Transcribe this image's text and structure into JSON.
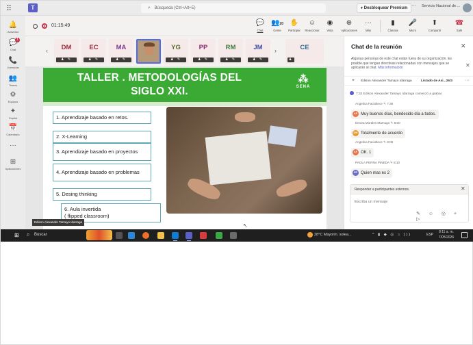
{
  "titlebar": {
    "search_placeholder": "Búsqueda (Ctrl+Alt+E)",
    "premium_label": "Desbloquear Premium",
    "more": "···",
    "org_label": "Servicio Nacional de ..."
  },
  "rail": {
    "items": [
      {
        "icon": "🔔",
        "label": "Actividad",
        "badge": ""
      },
      {
        "icon": "💬",
        "label": "Chat",
        "badge": "1"
      },
      {
        "icon": "📞",
        "label": "Llamadas",
        "badge": ""
      },
      {
        "icon": "👥",
        "label": "Teams",
        "badge": ""
      },
      {
        "icon": "⚙",
        "label": "Equipos",
        "badge": ""
      },
      {
        "icon": "✦",
        "label": "Copilot",
        "badge": ""
      },
      {
        "icon": "📅",
        "label": "Calendario",
        "badge": ""
      },
      {
        "icon": "···",
        "label": "",
        "badge": ""
      },
      {
        "icon": "⊞",
        "label": "Aplicaciones",
        "badge": ""
      }
    ]
  },
  "meeting": {
    "timer": "01:15:49",
    "controls": [
      {
        "icon": "💬",
        "label": "Chat",
        "active": true
      },
      {
        "icon": "👥",
        "label": "Gente",
        "count": "20"
      },
      {
        "icon": "✋",
        "label": "Participar"
      },
      {
        "icon": "☺",
        "label": "Reaccionar"
      },
      {
        "icon": "◉",
        "label": "Vista"
      },
      {
        "icon": "⊕",
        "label": "Aplicaciones"
      },
      {
        "icon": "···",
        "label": "Más"
      },
      {
        "icon": "▮",
        "label": "Cámara"
      },
      {
        "icon": "🎤",
        "label": "Micro"
      },
      {
        "icon": "⬆",
        "label": "Compartir"
      }
    ],
    "leave_label": "Salir",
    "leave_icon": "☎"
  },
  "participants": [
    {
      "initials": "DM",
      "color": "#9b2d3f"
    },
    {
      "initials": "EC",
      "color": "#9b2d3f"
    },
    {
      "initials": "MA",
      "color": "#7a3d8c"
    },
    {
      "initials": "",
      "video": true
    },
    {
      "initials": "YG",
      "color": "#5a6a2a"
    },
    {
      "initials": "PP",
      "color": "#8c2d6e"
    },
    {
      "initials": "RM",
      "color": "#3e7a3a"
    },
    {
      "initials": "JM",
      "color": "#3d4fa8"
    },
    {
      "initials": "CE",
      "color": "#2d6d8c"
    }
  ],
  "slide": {
    "title_line1": "TALLER . METODOLOGÍAS DEL",
    "title_line2": "SIGLO XXI.",
    "logo_text": "SENA",
    "items": [
      "1. Aprendizaje basado en retos.",
      "2. X-Learning",
      "3. Aprendizaje basado en proyectos",
      "4. Aprendizaje basado en problemas",
      "5. Desing thinking"
    ],
    "item6_line1": "6. Aula invertida",
    "item6_line2": "( flipped classroom)",
    "presenter_tooltip": "Edison Alexander Tamayo Idarraga"
  },
  "chat": {
    "title": "Chat de la reunión",
    "notice": "Algunas personas de este chat están fuera de su organización. Es posible que tengan directivas relacionadas con mensajes que se aplicarán al chat.",
    "notice_link": "Más información",
    "pinned_name": "Edison Alexander Tamayo Idarraga",
    "pinned_list": "Listado de Asi...26/3",
    "system_message": "7:32  Edison Alexander Tamayo Idarraga comenzó a grabar.",
    "messages": [
      {
        "meta": "Angelica Facioltece  ✎  7:36",
        "initials": "AF",
        "color": "#e8754a",
        "text": "Muy buenos días, bendecido día a todos."
      },
      {
        "meta": "Dinora Morales Mamugo  ✎  8:00",
        "initials": "DM",
        "color": "#e89a2a",
        "text": "Totalmente de acuerdo"
      },
      {
        "meta": "Angelica Facioltece  ✎  8:08",
        "initials": "AF",
        "color": "#e8754a",
        "text": "OK. 1"
      },
      {
        "meta": "PAOLA PERNA PINEDA  ✎  8:10",
        "initials": "PP",
        "color": "#6b6fc7",
        "text": "Quien mas es 2"
      }
    ],
    "compose_label": "Responder a participantes externos.",
    "compose_placeholder": "Escriba un mensaje",
    "compose_tools": "✎ ☺ ◎ + ▷"
  },
  "taskbar": {
    "start_icon": "⊞",
    "search_label": "Buscar",
    "weather": "28°C  Mayorm. solea...",
    "tray": "^ ▮ ◆ ◎ ⌂ ))) ",
    "lang": "ESP",
    "time": "8:11 a. m.",
    "date": "7/05/2026"
  }
}
